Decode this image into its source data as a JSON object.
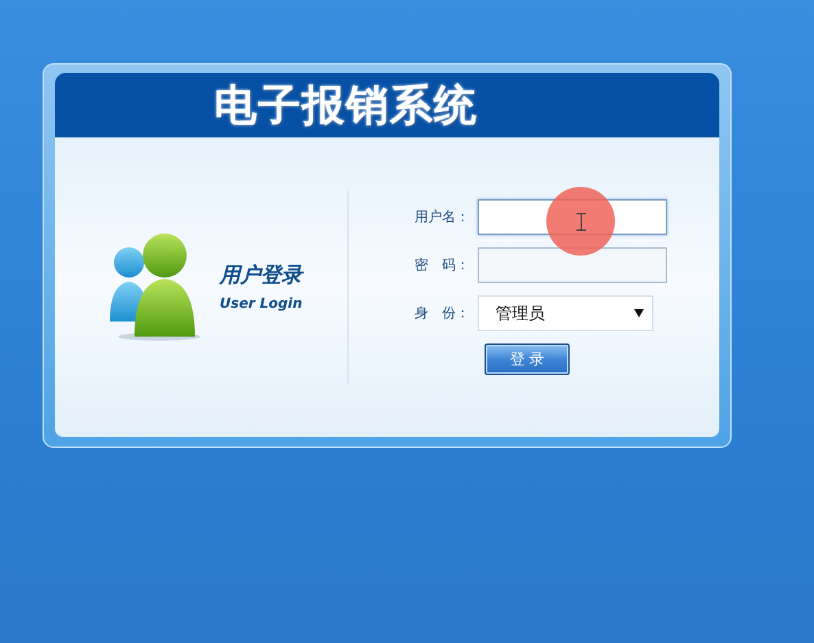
{
  "header": {
    "title": "电子报销系统"
  },
  "intro": {
    "title": "用户登录",
    "subtitle": "User Login"
  },
  "form": {
    "fields": [
      {
        "kind": "text",
        "label": "用户名：",
        "focused": true
      },
      {
        "kind": "password",
        "label": "密　码：",
        "focused": false
      },
      {
        "kind": "select",
        "label": "身　份：",
        "value": "管理员",
        "focused": false
      }
    ],
    "submit": "登 录"
  }
}
